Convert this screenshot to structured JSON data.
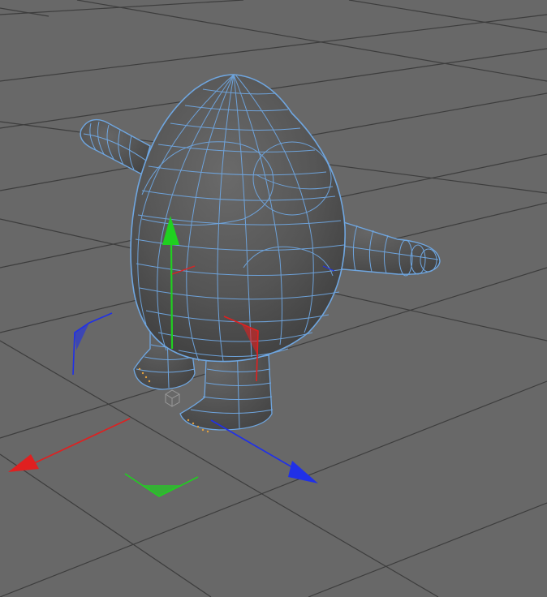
{
  "viewport": {
    "background_color": "#686868",
    "grid_color": "#3d3d3d",
    "mesh_fill_color": "#5b5b5b",
    "mesh_wire_color": "#6fa6e0",
    "selection_highlight_color": "#e0a040"
  },
  "gizmo": {
    "x_axis_color": "#e02020",
    "y_axis_color": "#20d020",
    "z_axis_color": "#2030e8",
    "icons": [
      "move-x-arrow-icon",
      "move-y-arrow-icon",
      "move-z-arrow-icon",
      "plane-handle-icon",
      "pivot-cube-icon"
    ]
  }
}
